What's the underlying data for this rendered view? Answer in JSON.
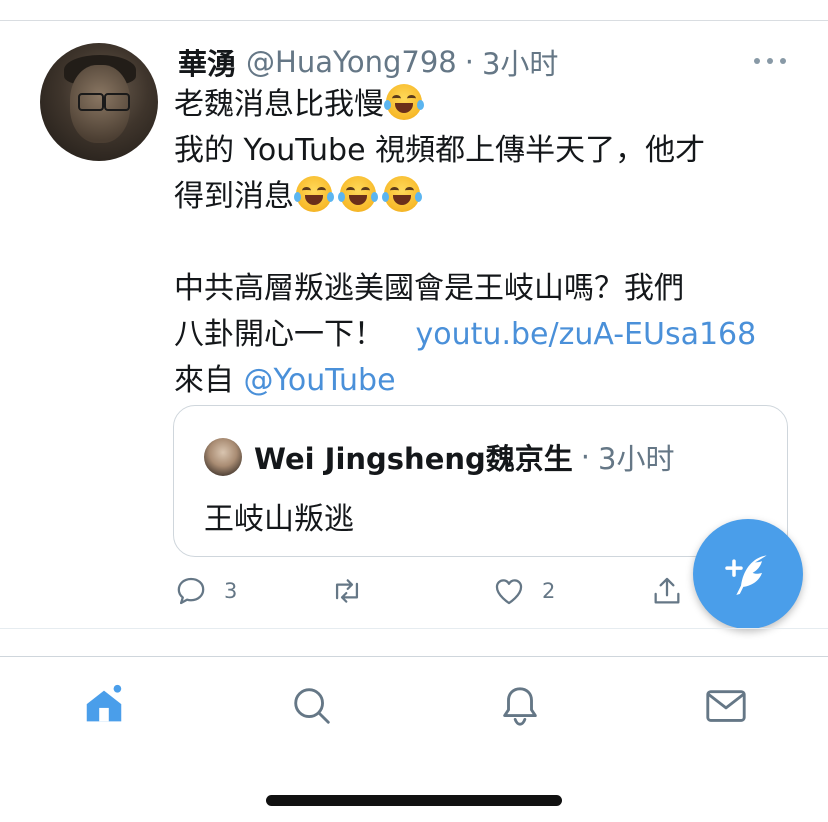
{
  "tweet": {
    "display_name": "華湧",
    "handle": "@HuaYong798",
    "separator": "·",
    "time": "3小时",
    "lines": {
      "l1": "老魏消息比我慢",
      "l2": "我的 YouTube 視頻都上傳半天了，他才",
      "l3": "得到消息",
      "l4": "中共高層叛逃美國會是王岐山嗎？我們",
      "l5_text": "八卦開心一下！ ",
      "l5_link": "youtu.be/zuA-EUsa168",
      "l6_text": "來自 ",
      "l6_link": "@YouTube"
    },
    "emoji_name": "tears-of-joy-emoji"
  },
  "quote": {
    "name": "Wei Jingsheng魏京生",
    "separator": "·",
    "time": "3小时",
    "text": "王岐山叛逃"
  },
  "actions": {
    "reply_count": "3",
    "like_count": "2"
  },
  "colors": {
    "accent": "#4a9eea",
    "link": "#4a90d9",
    "muted": "#657786",
    "text": "#14171a"
  },
  "tabs": [
    "home-icon",
    "search-icon",
    "notifications-icon",
    "messages-icon"
  ]
}
